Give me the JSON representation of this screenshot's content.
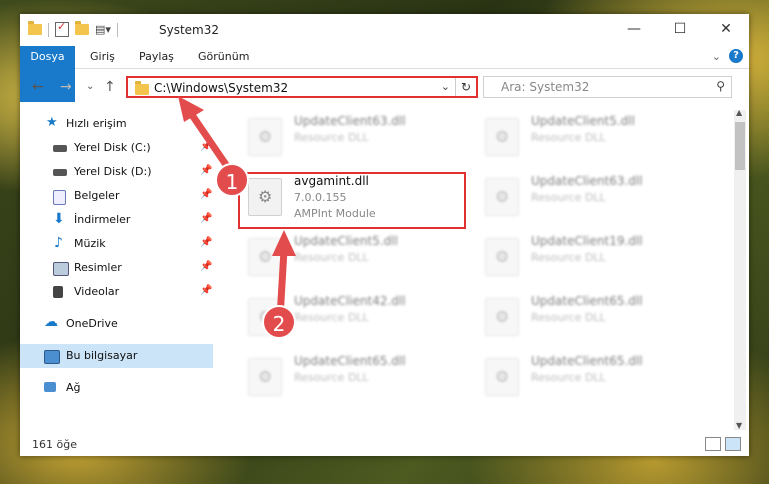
{
  "window": {
    "title": "System32"
  },
  "ribbon": {
    "tabs": [
      "Dosya",
      "Giriş",
      "Paylaş",
      "Görünüm"
    ]
  },
  "address": {
    "path": "C:\\Windows\\System32"
  },
  "search": {
    "placeholder": "Ara: System32"
  },
  "sidebar": {
    "items": [
      {
        "label": "Hızlı erişim"
      },
      {
        "label": "Yerel Disk (C:)"
      },
      {
        "label": "Yerel Disk (D:)"
      },
      {
        "label": "Belgeler"
      },
      {
        "label": "İndirmeler"
      },
      {
        "label": "Müzik"
      },
      {
        "label": "Resimler"
      },
      {
        "label": "Videolar"
      },
      {
        "label": "OneDrive"
      },
      {
        "label": "Bu bilgisayar"
      },
      {
        "label": "Ağ"
      }
    ]
  },
  "files": [
    {
      "name": "UpdateClient63.dll",
      "line2": "Resource DLL",
      "line3": ""
    },
    {
      "name": "UpdateClient5.dll",
      "line2": "Resource DLL",
      "line3": ""
    },
    {
      "name": "avgamint.dll",
      "line2": "7.0.0.155",
      "line3": "AMPInt Module"
    },
    {
      "name": "UpdateClient63.dll",
      "line2": "Resource DLL",
      "line3": ""
    },
    {
      "name": "UpdateClient5.dll",
      "line2": "Resource DLL",
      "line3": ""
    },
    {
      "name": "UpdateClient19.dll",
      "line2": "Resource DLL",
      "line3": ""
    },
    {
      "name": "UpdateClient42.dll",
      "line2": "Resource DLL",
      "line3": ""
    },
    {
      "name": "UpdateClient65.dll",
      "line2": "Resource DLL",
      "line3": ""
    },
    {
      "name": "UpdateClient65.dll",
      "line2": "Resource DLL",
      "line3": ""
    },
    {
      "name": "UpdateClient65.dll",
      "line2": "Resource DLL",
      "line3": ""
    }
  ],
  "status": {
    "count": "161 öğe"
  },
  "annotations": {
    "step1": "1",
    "step2": "2"
  },
  "colors": {
    "accent": "#1979ca",
    "highlight": "#e03030",
    "badge": "#e34c4c"
  }
}
